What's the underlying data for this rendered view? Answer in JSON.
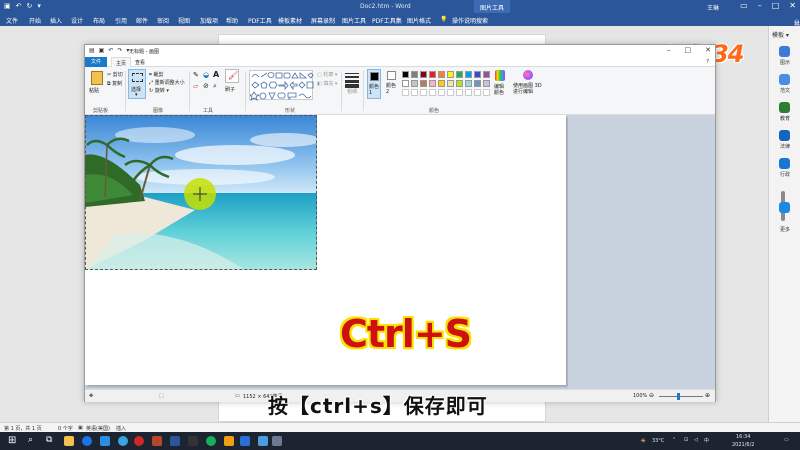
{
  "word": {
    "title": "Doc2.htm - Word",
    "context_tab": "图片工具",
    "user": "王琳",
    "tabs": [
      "文件",
      "开始",
      "插入",
      "设计",
      "布局",
      "引用",
      "邮件",
      "审阅",
      "视图",
      "加载项",
      "帮助",
      "PDF工具",
      "模板素材",
      "屏幕录制",
      "图片工具",
      "PDF工具集",
      "图片格式"
    ],
    "search": "操作说明搜索",
    "share": "共享",
    "right_panel": {
      "mode": "模板",
      "items": [
        "图示",
        "范文",
        "教育",
        "法律",
        "行政",
        "更多"
      ]
    },
    "status": {
      "page": "第 1 页，共 1 页",
      "words": "0 个字",
      "lang": "英语(美国)",
      "mode": "插入"
    }
  },
  "logo": "ﾊﾉwj234",
  "paint": {
    "title": "无标题 - 画图",
    "tabs": {
      "file": "文件",
      "home": "主页",
      "view": "查看"
    },
    "clipboard": {
      "paste": "粘贴",
      "cut": "剪切",
      "copy": "复制",
      "group": "剪贴板"
    },
    "image": {
      "select": "选择",
      "crop": "裁剪",
      "resize": "重新调整大小",
      "rotate": "旋转",
      "group": "图像"
    },
    "tools": {
      "brush": "刷子",
      "group": "工具"
    },
    "shapes": {
      "outline": "轮廓",
      "fill": "填充",
      "group": "形状"
    },
    "size": "粗细",
    "colors": {
      "color1": "颜色 1",
      "color2": "颜色 2",
      "edit": "编辑颜色",
      "paint3d": "使用画图 3D 进行编辑",
      "group": "颜色",
      "palette": [
        "#000000",
        "#7f7f7f",
        "#880015",
        "#ed1c24",
        "#ff7f27",
        "#fff200",
        "#22b14c",
        "#00a2e8",
        "#3f48cc",
        "#a349a4",
        "#ffffff",
        "#c3c3c3",
        "#b97a57",
        "#ffaec9",
        "#ffc90e",
        "#efe4b0",
        "#b5e61d",
        "#99d9ea",
        "#7092be",
        "#c8bfe7"
      ]
    },
    "status": {
      "dims": "1152 × 648像素",
      "zoom": "100%"
    }
  },
  "overlay": {
    "shortcut": "Ctrl+S",
    "subtitle": "按【ctrl+s】保存即可"
  },
  "taskbar": {
    "temp": "33°C",
    "time": "16:34",
    "date": "2021/6/2"
  }
}
